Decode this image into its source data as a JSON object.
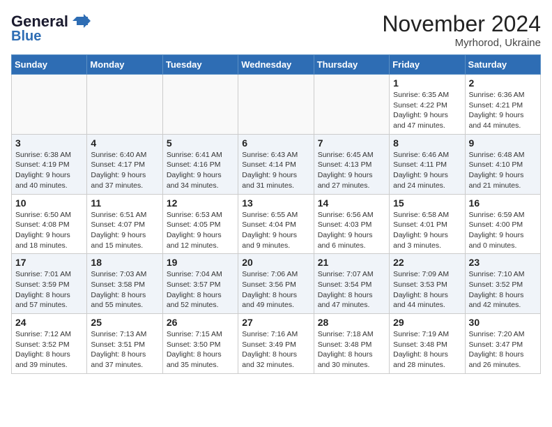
{
  "logo": {
    "part1": "General",
    "part2": "Blue"
  },
  "title": "November 2024",
  "location": "Myrhorod, Ukraine",
  "days_of_week": [
    "Sunday",
    "Monday",
    "Tuesday",
    "Wednesday",
    "Thursday",
    "Friday",
    "Saturday"
  ],
  "weeks": [
    [
      {
        "day": "",
        "info": ""
      },
      {
        "day": "",
        "info": ""
      },
      {
        "day": "",
        "info": ""
      },
      {
        "day": "",
        "info": ""
      },
      {
        "day": "",
        "info": ""
      },
      {
        "day": "1",
        "info": "Sunrise: 6:35 AM\nSunset: 4:22 PM\nDaylight: 9 hours and 47 minutes."
      },
      {
        "day": "2",
        "info": "Sunrise: 6:36 AM\nSunset: 4:21 PM\nDaylight: 9 hours and 44 minutes."
      }
    ],
    [
      {
        "day": "3",
        "info": "Sunrise: 6:38 AM\nSunset: 4:19 PM\nDaylight: 9 hours and 40 minutes."
      },
      {
        "day": "4",
        "info": "Sunrise: 6:40 AM\nSunset: 4:17 PM\nDaylight: 9 hours and 37 minutes."
      },
      {
        "day": "5",
        "info": "Sunrise: 6:41 AM\nSunset: 4:16 PM\nDaylight: 9 hours and 34 minutes."
      },
      {
        "day": "6",
        "info": "Sunrise: 6:43 AM\nSunset: 4:14 PM\nDaylight: 9 hours and 31 minutes."
      },
      {
        "day": "7",
        "info": "Sunrise: 6:45 AM\nSunset: 4:13 PM\nDaylight: 9 hours and 27 minutes."
      },
      {
        "day": "8",
        "info": "Sunrise: 6:46 AM\nSunset: 4:11 PM\nDaylight: 9 hours and 24 minutes."
      },
      {
        "day": "9",
        "info": "Sunrise: 6:48 AM\nSunset: 4:10 PM\nDaylight: 9 hours and 21 minutes."
      }
    ],
    [
      {
        "day": "10",
        "info": "Sunrise: 6:50 AM\nSunset: 4:08 PM\nDaylight: 9 hours and 18 minutes."
      },
      {
        "day": "11",
        "info": "Sunrise: 6:51 AM\nSunset: 4:07 PM\nDaylight: 9 hours and 15 minutes."
      },
      {
        "day": "12",
        "info": "Sunrise: 6:53 AM\nSunset: 4:05 PM\nDaylight: 9 hours and 12 minutes."
      },
      {
        "day": "13",
        "info": "Sunrise: 6:55 AM\nSunset: 4:04 PM\nDaylight: 9 hours and 9 minutes."
      },
      {
        "day": "14",
        "info": "Sunrise: 6:56 AM\nSunset: 4:03 PM\nDaylight: 9 hours and 6 minutes."
      },
      {
        "day": "15",
        "info": "Sunrise: 6:58 AM\nSunset: 4:01 PM\nDaylight: 9 hours and 3 minutes."
      },
      {
        "day": "16",
        "info": "Sunrise: 6:59 AM\nSunset: 4:00 PM\nDaylight: 9 hours and 0 minutes."
      }
    ],
    [
      {
        "day": "17",
        "info": "Sunrise: 7:01 AM\nSunset: 3:59 PM\nDaylight: 8 hours and 57 minutes."
      },
      {
        "day": "18",
        "info": "Sunrise: 7:03 AM\nSunset: 3:58 PM\nDaylight: 8 hours and 55 minutes."
      },
      {
        "day": "19",
        "info": "Sunrise: 7:04 AM\nSunset: 3:57 PM\nDaylight: 8 hours and 52 minutes."
      },
      {
        "day": "20",
        "info": "Sunrise: 7:06 AM\nSunset: 3:56 PM\nDaylight: 8 hours and 49 minutes."
      },
      {
        "day": "21",
        "info": "Sunrise: 7:07 AM\nSunset: 3:54 PM\nDaylight: 8 hours and 47 minutes."
      },
      {
        "day": "22",
        "info": "Sunrise: 7:09 AM\nSunset: 3:53 PM\nDaylight: 8 hours and 44 minutes."
      },
      {
        "day": "23",
        "info": "Sunrise: 7:10 AM\nSunset: 3:52 PM\nDaylight: 8 hours and 42 minutes."
      }
    ],
    [
      {
        "day": "24",
        "info": "Sunrise: 7:12 AM\nSunset: 3:52 PM\nDaylight: 8 hours and 39 minutes."
      },
      {
        "day": "25",
        "info": "Sunrise: 7:13 AM\nSunset: 3:51 PM\nDaylight: 8 hours and 37 minutes."
      },
      {
        "day": "26",
        "info": "Sunrise: 7:15 AM\nSunset: 3:50 PM\nDaylight: 8 hours and 35 minutes."
      },
      {
        "day": "27",
        "info": "Sunrise: 7:16 AM\nSunset: 3:49 PM\nDaylight: 8 hours and 32 minutes."
      },
      {
        "day": "28",
        "info": "Sunrise: 7:18 AM\nSunset: 3:48 PM\nDaylight: 8 hours and 30 minutes."
      },
      {
        "day": "29",
        "info": "Sunrise: 7:19 AM\nSunset: 3:48 PM\nDaylight: 8 hours and 28 minutes."
      },
      {
        "day": "30",
        "info": "Sunrise: 7:20 AM\nSunset: 3:47 PM\nDaylight: 8 hours and 26 minutes."
      }
    ]
  ]
}
